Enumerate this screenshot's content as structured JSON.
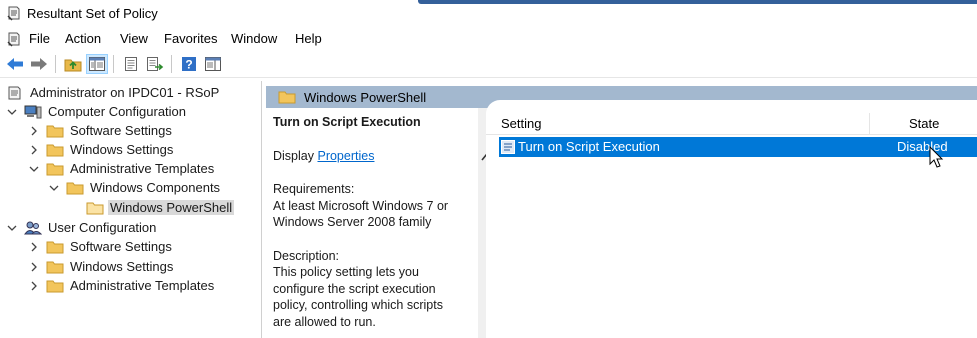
{
  "window": {
    "title": "Resultant Set of Policy"
  },
  "menu": [
    "File",
    "Action",
    "View",
    "Favorites",
    "Window",
    "Help"
  ],
  "toolbar": {
    "buttons": [
      "back-icon",
      "forward-icon",
      "up-folder-icon",
      "show-hide-tree-icon",
      "properties-icon",
      "export-list-icon",
      "help-icon",
      "show-action-pane-icon"
    ]
  },
  "tree": {
    "root": "Administrator on IPDC01 - RSoP",
    "computer_config": "Computer Configuration",
    "cc_software": "Software Settings",
    "cc_windows": "Windows Settings",
    "cc_admin": "Administrative Templates",
    "cc_components": "Windows Components",
    "cc_powershell": "Windows PowerShell",
    "user_config": "User Configuration",
    "uc_software": "Software Settings",
    "uc_windows": "Windows Settings",
    "uc_admin": "Administrative Templates"
  },
  "right_header": {
    "label": "Windows PowerShell"
  },
  "description": {
    "title": "Turn on Script Execution",
    "display_prefix": "Display",
    "display_link": "Properties",
    "requirements_label": "Requirements:",
    "requirements_line1": "At least Microsoft Windows 7 or",
    "requirements_line2": "Windows Server 2008 family",
    "description_label": "Description:",
    "description_line1": "This policy setting lets you",
    "description_line2": "configure the script execution",
    "description_line3": "policy, controlling which scripts",
    "description_line4": "are allowed to run."
  },
  "list": {
    "columns": {
      "setting": "Setting",
      "state": "State"
    },
    "rows": [
      {
        "setting": "Turn on Script Execution",
        "state": "Disabled"
      }
    ]
  },
  "colors": {
    "selection": "#0078d7",
    "header_band": "#a3b8cf",
    "link": "#0066cc"
  }
}
